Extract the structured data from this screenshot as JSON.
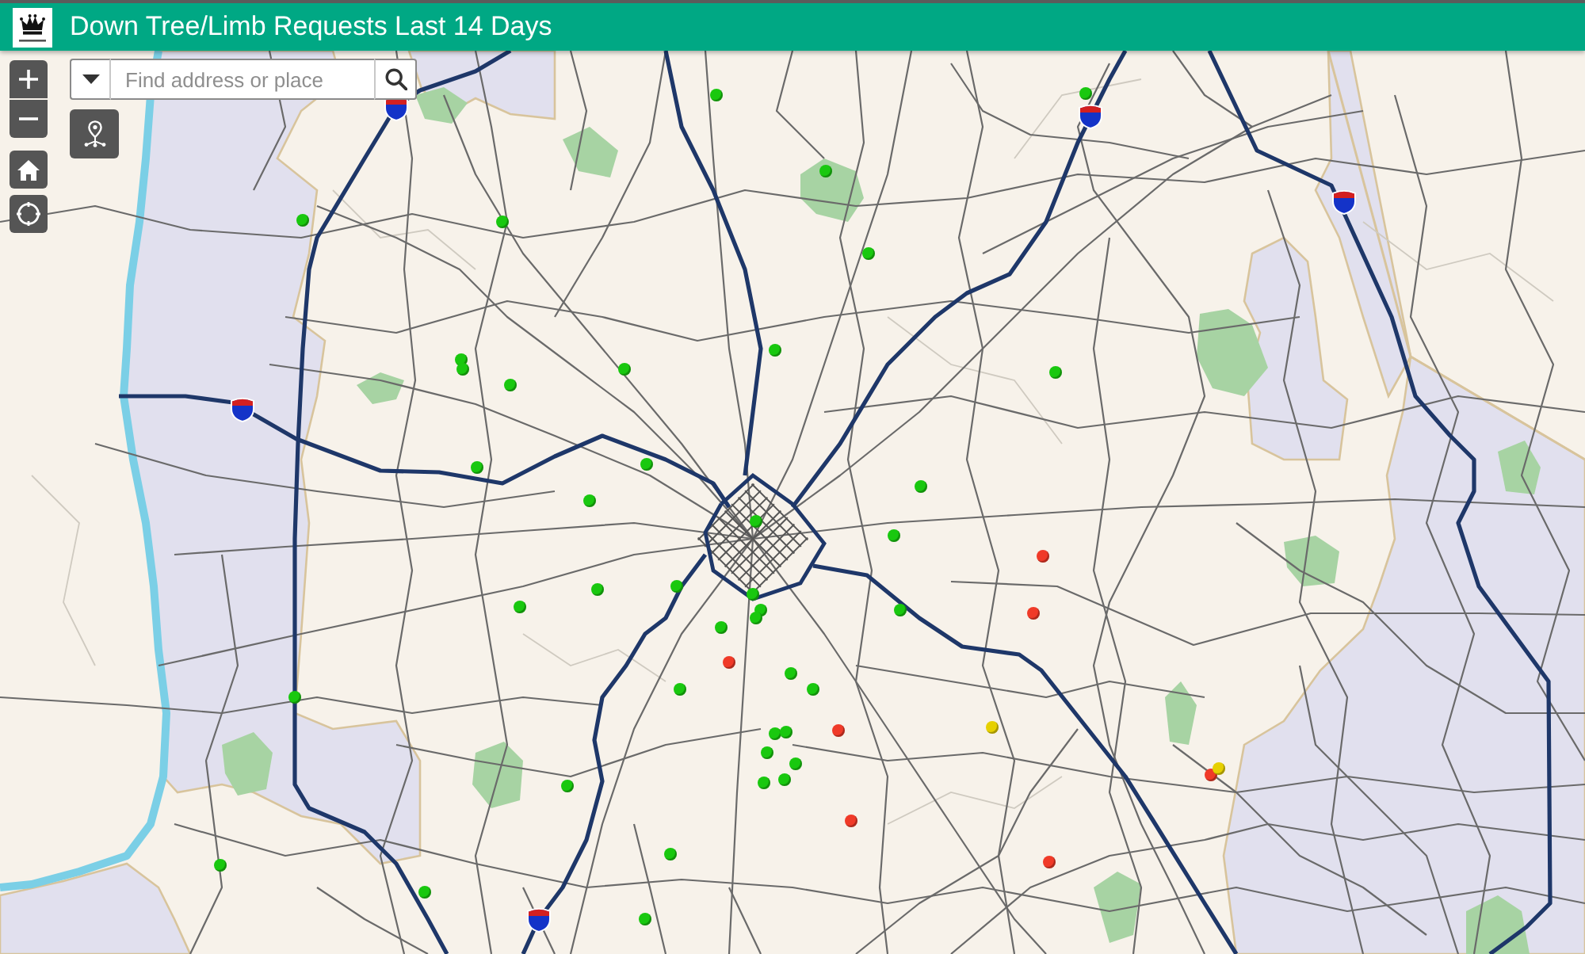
{
  "header": {
    "title": "Down Tree/Limb Requests Last 14 Days"
  },
  "search": {
    "placeholder": "Find address or place"
  },
  "map": {
    "markers": [
      {
        "color": "#19c80f"
      },
      {
        "color": "#19c80f"
      },
      {
        "color": "#19c80f"
      },
      {
        "color": "#19c80f"
      },
      {
        "color": "#19c80f"
      },
      {
        "color": "#19c80f"
      },
      {
        "color": "#19c80f"
      },
      {
        "color": "#19c80f"
      },
      {
        "color": "#19c80f"
      },
      {
        "color": "#19c80f"
      },
      {
        "color": "#19c80f"
      },
      {
        "color": "#19c80f"
      },
      {
        "color": "#19c80f"
      },
      {
        "color": "#19c80f"
      },
      {
        "color": "#19c80f"
      },
      {
        "color": "#19c80f"
      },
      {
        "color": "#19c80f"
      },
      {
        "color": "#19c80f"
      },
      {
        "color": "#f03a28"
      },
      {
        "color": "#19c80f"
      },
      {
        "color": "#19c80f"
      },
      {
        "color": "#19c80f"
      },
      {
        "color": "#19c80f"
      },
      {
        "color": "#19c80f"
      },
      {
        "color": "#19c80f"
      },
      {
        "color": "#f03a28"
      },
      {
        "color": "#19c80f"
      },
      {
        "color": "#19c80f"
      },
      {
        "color": "#f03a28"
      },
      {
        "color": "#19c80f"
      },
      {
        "color": "#19c80f"
      },
      {
        "color": "#19c80f"
      },
      {
        "color": "#19c80f"
      },
      {
        "color": "#19c80f"
      },
      {
        "color": "#19c80f"
      },
      {
        "color": "#f03a28"
      },
      {
        "color": "#e6d000"
      },
      {
        "color": "#19c80f"
      },
      {
        "color": "#19c80f"
      },
      {
        "color": "#19c80f"
      },
      {
        "color": "#19c80f"
      },
      {
        "color": "#19c80f"
      },
      {
        "color": "#f03a28"
      },
      {
        "color": "#e6d000"
      },
      {
        "color": "#f03a28"
      },
      {
        "color": "#19c80f"
      },
      {
        "color": "#f03a28"
      },
      {
        "color": "#19c80f"
      },
      {
        "color": "#19c80f"
      },
      {
        "color": "#19c80f"
      }
    ]
  }
}
